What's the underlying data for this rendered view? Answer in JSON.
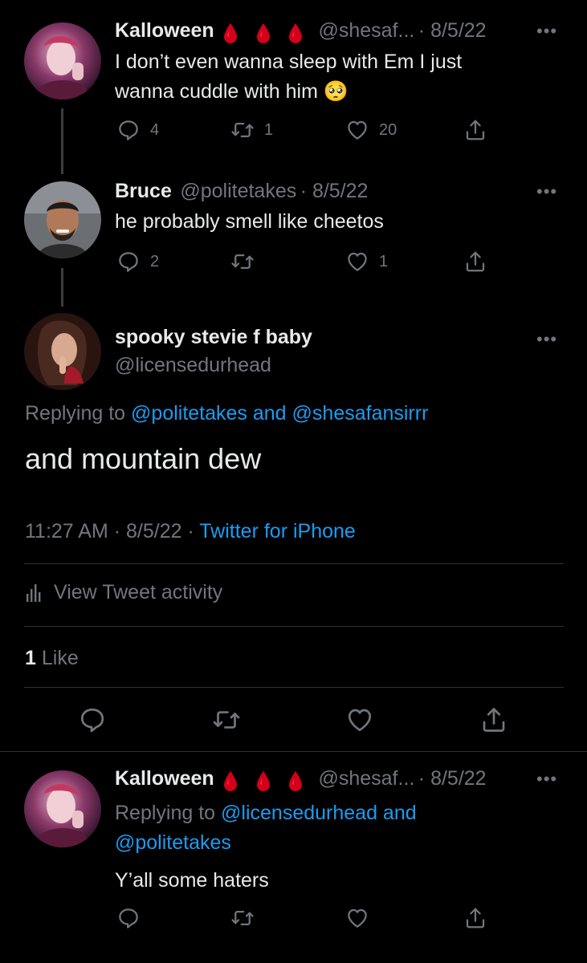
{
  "tweets": [
    {
      "display_name": "Kalloween",
      "handle": "@shesaf...",
      "date": "· 8/5/22",
      "text_line1": "I don’t even wanna sleep with Em I just",
      "text_line2": "wanna cuddle with him",
      "emoji": "🥺",
      "replies": "4",
      "retweets": "1",
      "likes": "20"
    },
    {
      "display_name": "Bruce",
      "handle": "@politetakes",
      "date": "· 8/5/22",
      "text": "he probably smell like cheetos",
      "replies": "2",
      "retweets": "",
      "likes": "1"
    }
  ],
  "focused": {
    "display_name": "spooky stevie f baby",
    "handle": "@licensedurhead",
    "replying_prefix": "Replying to",
    "replying_users": "@politetakes and @shesafansirrr",
    "text": "and mountain dew",
    "time": "11:27 AM · 8/5/22 ·",
    "source": "Twitter for iPhone",
    "activity_label": "View Tweet activity",
    "like_count": "1",
    "like_label": "Like"
  },
  "reply": {
    "display_name": "Kalloween",
    "handle": "@shesaf...",
    "date": "· 8/5/22",
    "replying_prefix": "Replying to",
    "replying_line1": "@licensedurhead and",
    "replying_line2": "@politetakes",
    "text": "Y’all some haters"
  },
  "colors": {
    "background": "#000000",
    "text": "#e7e9ea",
    "muted": "#71767b",
    "link": "#1d9bf0",
    "blood": "#d4001a"
  },
  "icons": [
    "reply-icon",
    "retweet-icon",
    "like-icon",
    "share-icon",
    "more-icon",
    "activity-chart-icon",
    "blood-drop-icon"
  ]
}
